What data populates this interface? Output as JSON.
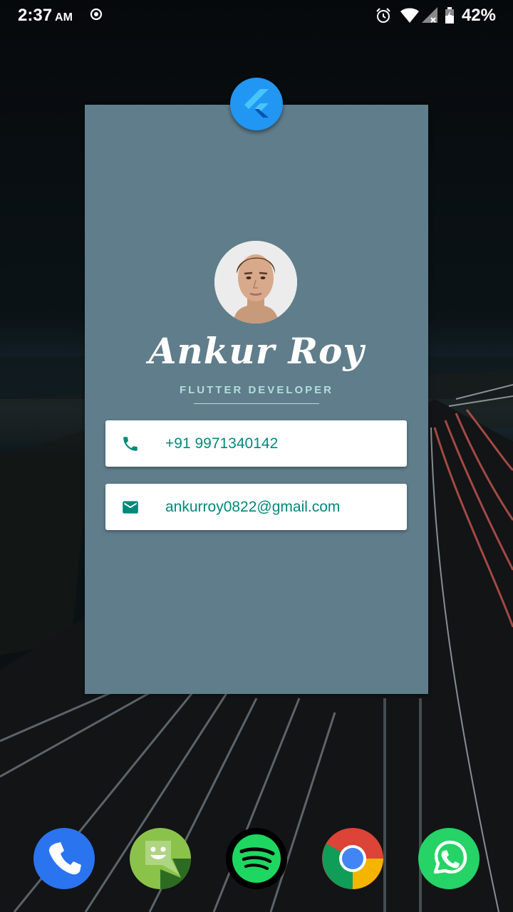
{
  "status_bar": {
    "time": "2:37",
    "ampm": "AM",
    "battery_percent": "42%",
    "icons": [
      "cast-icon",
      "alarm-icon",
      "wifi-icon",
      "signal-icon",
      "battery-icon"
    ]
  },
  "card": {
    "name": "Ankur Roy",
    "role": "FLUTTER DEVELOPER",
    "phone": "+91 9971340142",
    "email": "ankurroy0822@gmail.com",
    "colors": {
      "card_bg": "#607D8B",
      "accent": "#00897B",
      "role_text": "#B2DFDB",
      "badge": "#2196F3"
    }
  },
  "dock": {
    "apps": [
      "phone-app-icon",
      "messaging-app-icon",
      "spotify-app-icon",
      "chrome-app-icon",
      "whatsapp-app-icon"
    ]
  }
}
